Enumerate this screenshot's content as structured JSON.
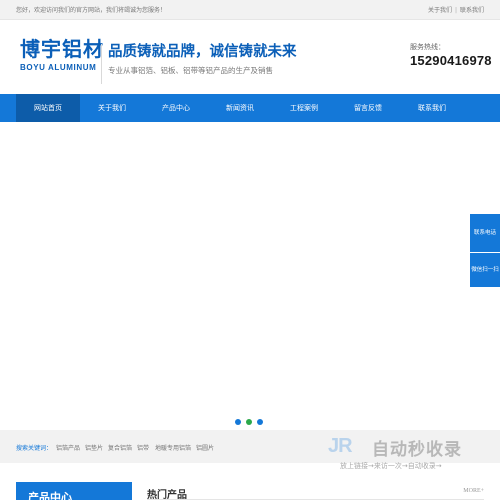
{
  "topbar": {
    "welcome": "您好，欢迎访问我们的官方网站，我们将竭诚为您服务！",
    "links": [
      "关于我们",
      "联系我们"
    ]
  },
  "header": {
    "logo_cn": "博宇铝材",
    "logo_en": "BOYU ALUMINUM",
    "slogan": "品质铸就品牌，诚信铸就未来",
    "subslogan": "专业从事铝箔、铝板、铝带等铝产品的生产及销售",
    "hotline_label": "服务热线：",
    "hotline_number": "15290416978"
  },
  "nav": {
    "items": [
      "网站首页",
      "关于我们",
      "产品中心",
      "新闻资讯",
      "工程案例",
      "留言反馈",
      "联系我们"
    ],
    "active_index": 0
  },
  "banner": {
    "dots": [
      "#1478d8",
      "#2ba84a",
      "#1478d8"
    ]
  },
  "keywords": {
    "label": "搜索关键词：",
    "items": [
      "铝箔产品",
      "铝垫片",
      "复合铝箔",
      "铝带",
      "地暖专用铝箔",
      "铝圆片"
    ]
  },
  "side": {
    "contact": "联系电话",
    "wechat": "微信扫一扫"
  },
  "watermark": {
    "logo": "JR",
    "title": "自动秒收录",
    "subtitle": "放上链接→来访一次→自动收录→"
  },
  "bottom": {
    "product_center": "产品中心",
    "hot_products": "热门产品",
    "more": "MORE+"
  },
  "colors": {
    "brand_blue": "#1478d8",
    "nav_active": "#0d5ca9",
    "logo_blue": "#0b5fb8"
  }
}
